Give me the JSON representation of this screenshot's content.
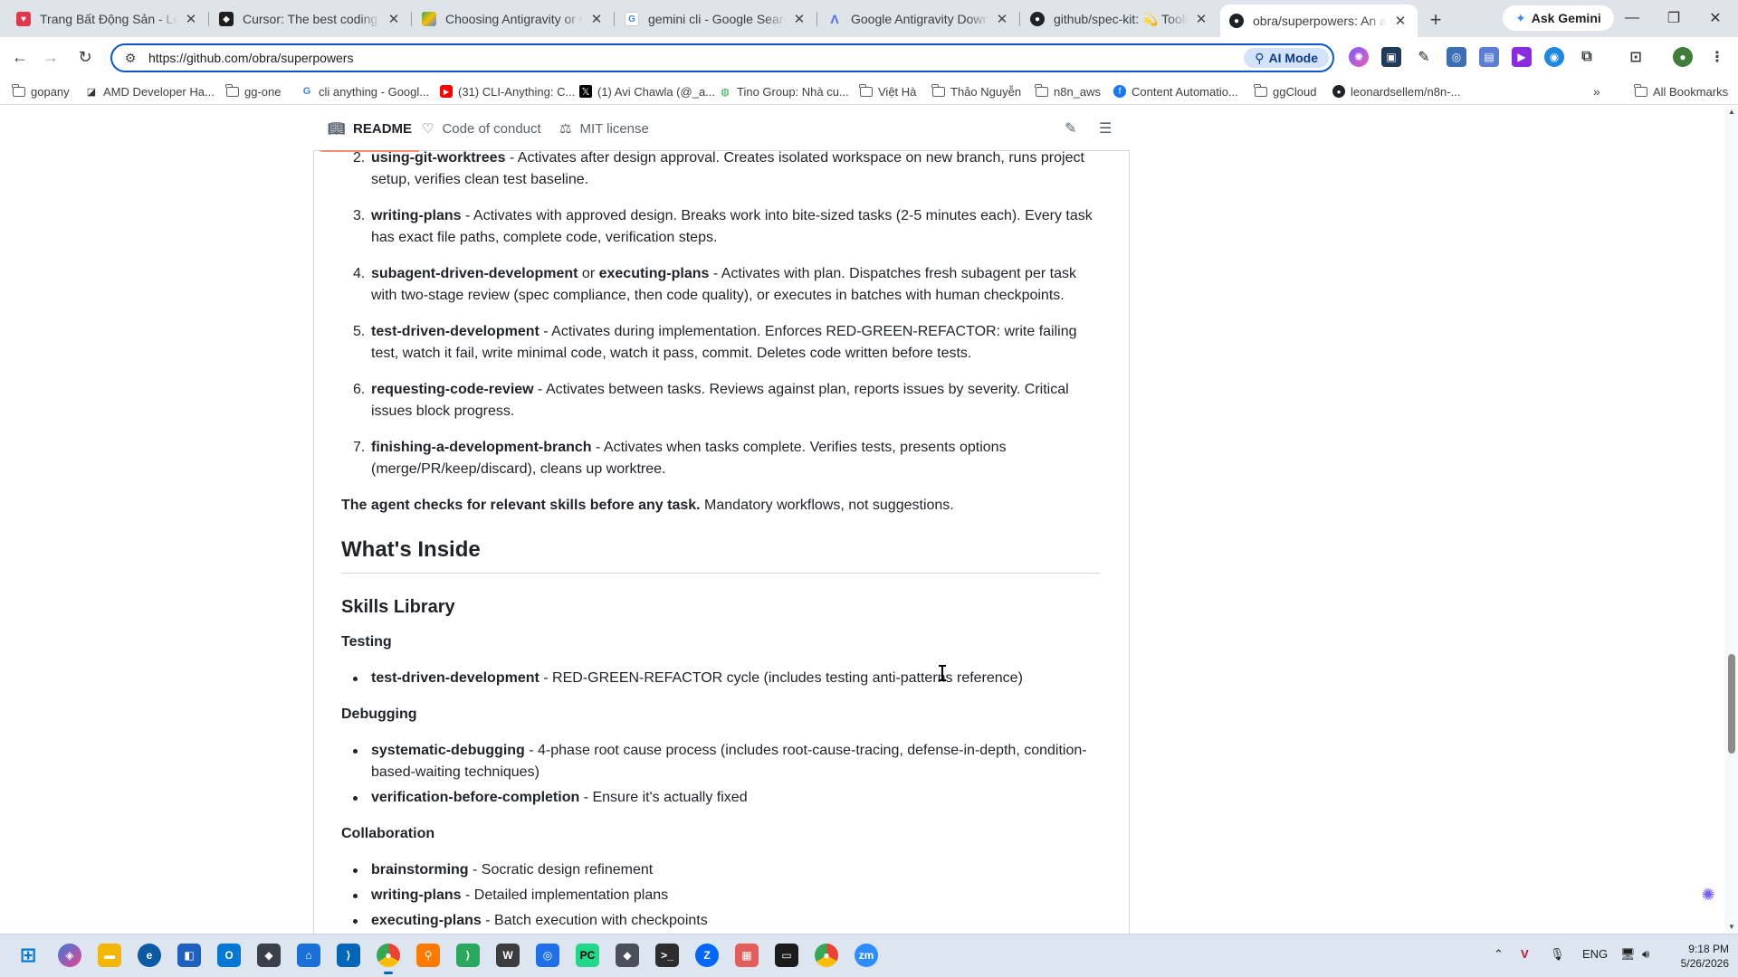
{
  "browser": {
    "tabs": [
      {
        "title": "Trang Bất Động Sản - Lovable",
        "favicon": "lovable-icon",
        "color": "#e2364a"
      },
      {
        "title": "Cursor: The best coding agent",
        "favicon": "cursor-icon",
        "color": "#1f1f1f"
      },
      {
        "title": "Choosing Antigravity or Gemini",
        "favicon": "google-drive-icon",
        "color": "#34a853"
      },
      {
        "title": "gemini cli - Google Search",
        "favicon": "google-icon",
        "color": "#4285f4"
      },
      {
        "title": "Google Antigravity Download",
        "favicon": "antigravity-icon",
        "color": "#4a6cf7"
      },
      {
        "title": "github/spec-kit: 💫 Toolkit to",
        "favicon": "github-icon",
        "color": "#1f2328"
      },
      {
        "title": "obra/superpowers: An agentic",
        "favicon": "github-icon",
        "color": "#1f2328",
        "active": true
      }
    ],
    "ask_gemini": "Ask Gemini",
    "url": "https://github.com/obra/superpowers",
    "ai_mode": "AI Mode",
    "bookmarks": [
      {
        "label": "gopany",
        "icon": "folder-icon"
      },
      {
        "label": "AMD Developer Ha...",
        "icon": "amd-icon"
      },
      {
        "label": "gg-one",
        "icon": "folder-icon"
      },
      {
        "label": "cli anything - Googl...",
        "icon": "google-icon"
      },
      {
        "label": "(31) CLI-Anything: C...",
        "icon": "youtube-icon"
      },
      {
        "label": "(1) Avi Chawla (@_a...",
        "icon": "x-icon"
      },
      {
        "label": "Tino Group: Nhà cu...",
        "icon": "tino-icon"
      },
      {
        "label": "Việt Hà",
        "icon": "folder-icon"
      },
      {
        "label": "Thảo Nguyễn",
        "icon": "folder-icon"
      },
      {
        "label": "n8n_aws",
        "icon": "folder-icon"
      },
      {
        "label": "Content Automatio...",
        "icon": "facebook-icon"
      },
      {
        "label": "ggCloud",
        "icon": "folder-icon"
      },
      {
        "label": "leonardsellem/n8n-...",
        "icon": "github-icon"
      }
    ],
    "all_bookmarks": "All Bookmarks"
  },
  "readme_tabs": {
    "readme": "README",
    "code_of_conduct": "Code of conduct",
    "license": "MIT license"
  },
  "content": {
    "workflow": [
      {
        "num": "2.",
        "name": "using-git-worktrees",
        "desc": " - Activates after design approval. Creates isolated workspace on new branch, runs project setup, verifies clean test baseline."
      },
      {
        "num": "3.",
        "name": "writing-plans",
        "desc": " - Activates with approved design. Breaks work into bite-sized tasks (2-5 minutes each). Every task has exact file paths, complete code, verification steps."
      },
      {
        "num": "4.",
        "name": "subagent-driven-development",
        "mid": " or ",
        "name2": "executing-plans",
        "desc": " - Activates with plan. Dispatches fresh subagent per task with two-stage review (spec compliance, then code quality), or executes in batches with human checkpoints."
      },
      {
        "num": "5.",
        "name": "test-driven-development",
        "desc": " - Activates during implementation. Enforces RED-GREEN-REFACTOR: write failing test, watch it fail, write minimal code, watch it pass, commit. Deletes code written before tests."
      },
      {
        "num": "6.",
        "name": "requesting-code-review",
        "desc": " - Activates between tasks. Reviews against plan, reports issues by severity. Critical issues block progress."
      },
      {
        "num": "7.",
        "name": "finishing-a-development-branch",
        "desc": " - Activates when tasks complete. Verifies tests, presents options (merge/PR/keep/discard), cleans up worktree."
      }
    ],
    "agent_note_bold": "The agent checks for relevant skills before any task.",
    "agent_note_rest": " Mandatory workflows, not suggestions.",
    "whats_inside": "What's Inside",
    "skills_library": "Skills Library",
    "testing": {
      "heading": "Testing",
      "items": [
        {
          "name": "test-driven-development",
          "desc": " - RED-GREEN-REFACTOR cycle (includes testing anti-patterns reference)"
        }
      ]
    },
    "debugging": {
      "heading": "Debugging",
      "items": [
        {
          "name": "systematic-debugging",
          "desc": " - 4-phase root cause process (includes root-cause-tracing, defense-in-depth, condition-based-waiting techniques)"
        },
        {
          "name": "verification-before-completion",
          "desc": " - Ensure it's actually fixed"
        }
      ]
    },
    "collaboration": {
      "heading": "Collaboration",
      "items": [
        {
          "name": "brainstorming",
          "desc": " - Socratic design refinement"
        },
        {
          "name": "writing-plans",
          "desc": " - Detailed implementation plans"
        },
        {
          "name": "executing-plans",
          "desc": " - Batch execution with checkpoints"
        }
      ]
    }
  },
  "taskbar": {
    "tray_lang": "ENG",
    "time": "9:18 PM",
    "date": "5/26/2026"
  }
}
